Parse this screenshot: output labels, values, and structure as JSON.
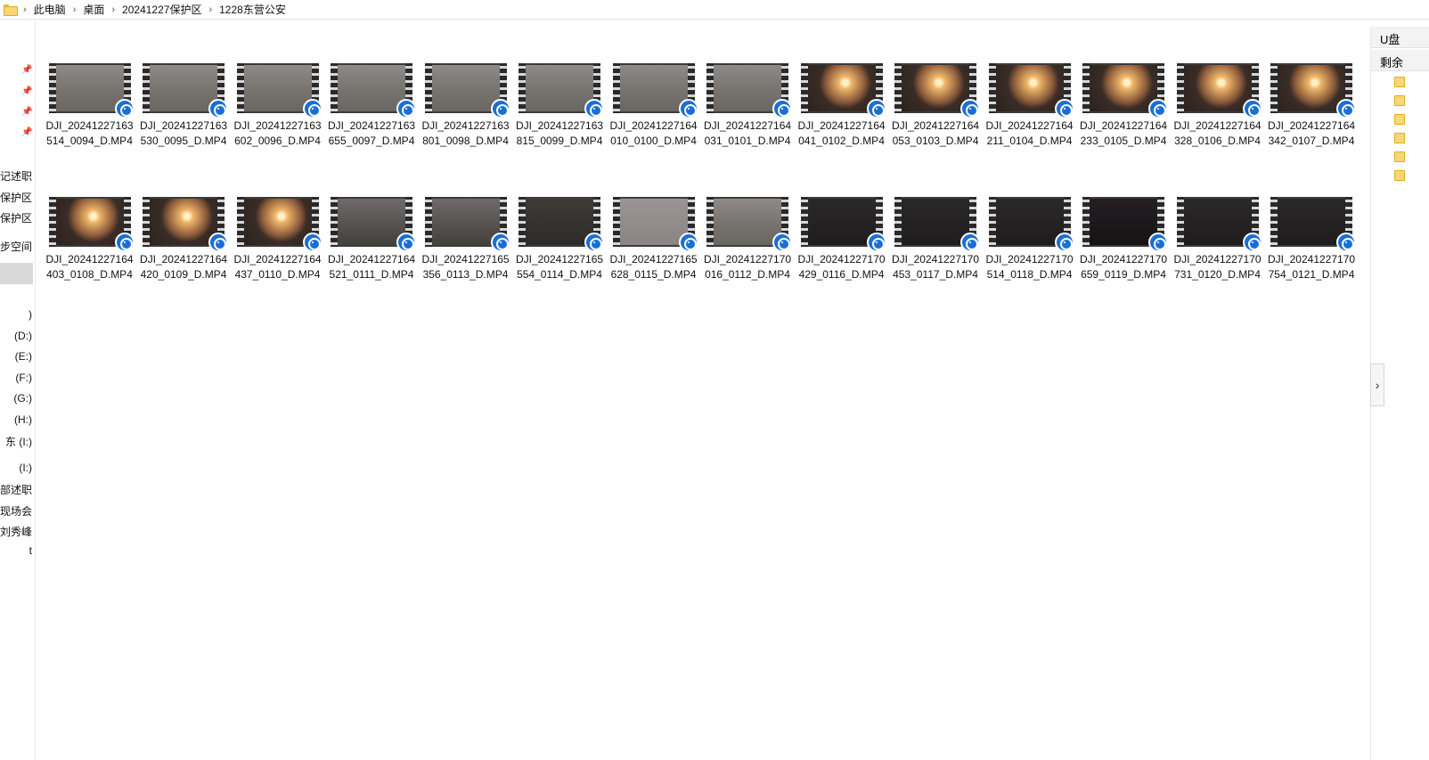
{
  "breadcrumb": [
    "此电脑",
    "桌面",
    "20241227保护区",
    "1228东营公安"
  ],
  "breadcrumb_separator": "›",
  "nav": {
    "pin_icon": "pin-icon",
    "items": [
      "书记述职",
      "保护区",
      "保护区",
      "步空间",
      ")",
      "(D:)",
      "(E:)",
      "(F:)",
      "(G:)",
      "(H:)",
      "东 (I:)",
      "(I:)",
      "部述职",
      "现场会",
      "刘秀峰",
      "t"
    ]
  },
  "right_panel": {
    "title": "U盘",
    "subtitle": "剩余",
    "expand_icon": "›"
  },
  "files": [
    {
      "name": "DJI_20241227163514_0094_D.MP4",
      "thumb": "road-gray"
    },
    {
      "name": "DJI_20241227163530_0095_D.MP4",
      "thumb": "road-gray"
    },
    {
      "name": "DJI_20241227163602_0096_D.MP4",
      "thumb": "road-gray"
    },
    {
      "name": "DJI_20241227163655_0097_D.MP4",
      "thumb": "road-gray"
    },
    {
      "name": "DJI_20241227163801_0098_D.MP4",
      "thumb": "road-gray"
    },
    {
      "name": "DJI_20241227163815_0099_D.MP4",
      "thumb": "road-gray"
    },
    {
      "name": "DJI_20241227164010_0100_D.MP4",
      "thumb": "road-gray"
    },
    {
      "name": "DJI_20241227164031_0101_D.MP4",
      "thumb": "road-gray"
    },
    {
      "name": "DJI_20241227164041_0102_D.MP4",
      "thumb": "sunset"
    },
    {
      "name": "DJI_20241227164053_0103_D.MP4",
      "thumb": "sunset"
    },
    {
      "name": "DJI_20241227164211_0104_D.MP4",
      "thumb": "sunset"
    },
    {
      "name": "DJI_20241227164233_0105_D.MP4",
      "thumb": "sunset"
    },
    {
      "name": "DJI_20241227164328_0106_D.MP4",
      "thumb": "sunset"
    },
    {
      "name": "DJI_20241227164342_0107_D.MP4",
      "thumb": "sunset"
    },
    {
      "name": "DJI_20241227164403_0108_D.MP4",
      "thumb": "sunset"
    },
    {
      "name": "DJI_20241227164420_0109_D.MP4",
      "thumb": "sunset"
    },
    {
      "name": "DJI_20241227164437_0110_D.MP4",
      "thumb": "sunset"
    },
    {
      "name": "DJI_20241227164521_0111_D.MP4",
      "thumb": "dusk"
    },
    {
      "name": "DJI_20241227165356_0113_D.MP4",
      "thumb": "dusk"
    },
    {
      "name": "DJI_20241227165554_0114_D.MP4",
      "thumb": "dusk-cars"
    },
    {
      "name": "DJI_20241227165628_0115_D.MP4",
      "thumb": "sky"
    },
    {
      "name": "DJI_20241227170016_0112_D.MP4",
      "thumb": "road-gray"
    },
    {
      "name": "DJI_20241227170429_0116_D.MP4",
      "thumb": "night"
    },
    {
      "name": "DJI_20241227170453_0117_D.MP4",
      "thumb": "night"
    },
    {
      "name": "DJI_20241227170514_0118_D.MP4",
      "thumb": "night"
    },
    {
      "name": "DJI_20241227170659_0119_D.MP4",
      "thumb": "night-lights"
    },
    {
      "name": "DJI_20241227170731_0120_D.MP4",
      "thumb": "night"
    },
    {
      "name": "DJI_20241227170754_0121_D.MP4",
      "thumb": "night"
    }
  ],
  "badge_icon": "video-reel-icon",
  "colors": {
    "badge": "#1a6fd6",
    "selection": "#d9d9d9",
    "folder": "#f8d775"
  }
}
